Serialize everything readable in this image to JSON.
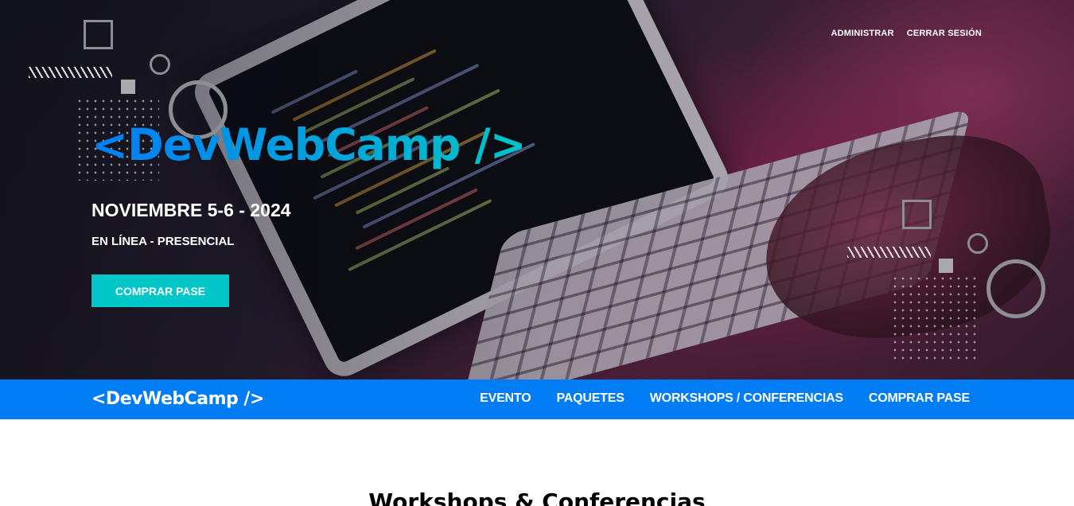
{
  "admin_nav": {
    "admin_label": "Administrar",
    "logout_label": "Cerrar Sesión"
  },
  "hero": {
    "brand": "<DevWebCamp />",
    "date": "Noviembre 5-6 - 2024",
    "mode": "En Línea - Presencial",
    "cta_label": "Comprar Pase"
  },
  "navbar": {
    "brand": "<DevWebCamp />",
    "items": [
      "Evento",
      "Paquetes",
      "Workshops / Conferencias",
      "Comprar Pase"
    ]
  },
  "section": {
    "title": "Workshops & Conferencias"
  },
  "colors": {
    "primary": "#007df4",
    "secondary": "#02c7c8"
  }
}
